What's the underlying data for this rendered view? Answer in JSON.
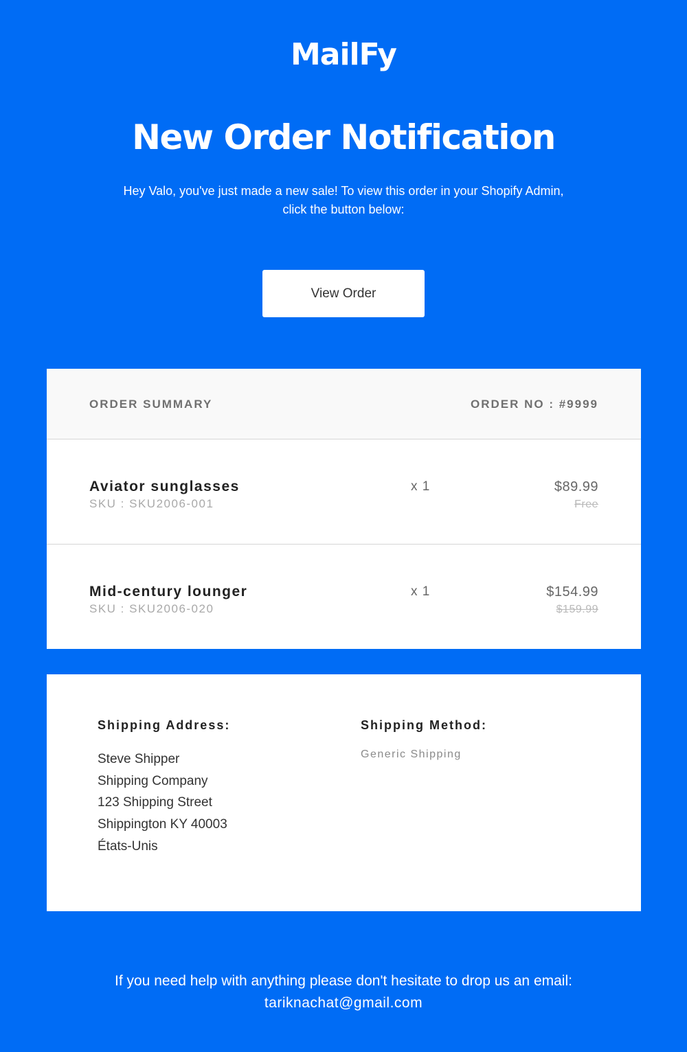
{
  "brand": {
    "logo": "MailFy"
  },
  "header": {
    "title": "New Order Notification",
    "intro": "Hey Valo, you've just made a new sale! To view this order in your Shopify Admin, click the button below:",
    "button_label": "View Order"
  },
  "order_summary": {
    "title": "ORDER SUMMARY",
    "order_no": "ORDER NO : #9999",
    "items": [
      {
        "name": "Aviator sunglasses",
        "sku": "SKU : SKU2006-001",
        "qty": "x 1",
        "price": "$89.99",
        "old_price": "Free"
      },
      {
        "name": "Mid-century lounger",
        "sku": "SKU : SKU2006-020",
        "qty": "x 1",
        "price": "$154.99",
        "old_price": "$159.99"
      }
    ]
  },
  "shipping": {
    "address_heading": "Shipping Address:",
    "address_lines": [
      "Steve Shipper",
      "Shipping Company",
      "123 Shipping Street",
      "Shippington KY 40003",
      "États-Unis"
    ],
    "method_heading": "Shipping Method:",
    "method_value": "Generic Shipping"
  },
  "footer": {
    "help_text": "If you need help with anything please don't hesitate to drop us an email:",
    "email": "tariknachat@gmail.com"
  },
  "colors": {
    "background": "#006cf5",
    "card": "#ffffff",
    "header_band": "#f9f9f9"
  }
}
